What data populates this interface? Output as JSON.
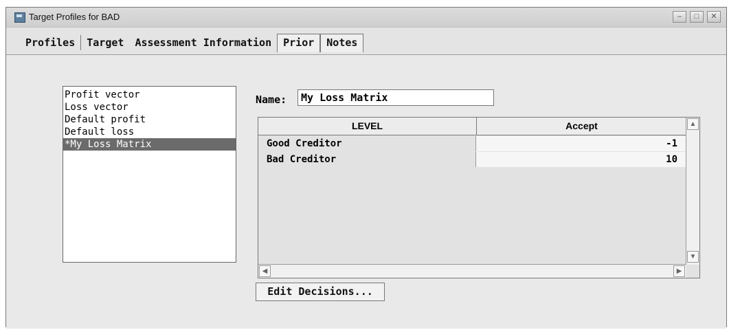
{
  "window": {
    "title": "Target Profiles for BAD",
    "controls": {
      "minimize": "–",
      "maximize": "□",
      "close": "✕"
    }
  },
  "tabs": [
    {
      "label": "Profiles"
    },
    {
      "label": "Target"
    },
    {
      "label": "Assessment Information"
    },
    {
      "label": "Prior"
    },
    {
      "label": "Notes"
    }
  ],
  "profiles_list": [
    {
      "label": "Profit vector"
    },
    {
      "label": "Loss vector"
    },
    {
      "label": "Default profit"
    },
    {
      "label": "Default loss"
    },
    {
      "label": "*My Loss Matrix"
    }
  ],
  "name_field": {
    "label": "Name:",
    "value": "My Loss Matrix"
  },
  "matrix": {
    "columns": [
      "LEVEL",
      "Accept"
    ],
    "rows": [
      {
        "level": "Good Creditor",
        "accept": "-1"
      },
      {
        "level": "Bad Creditor",
        "accept": "10"
      }
    ]
  },
  "edit_decisions_label": "Edit Decisions...",
  "icons": {
    "app": "target-profiles-icon",
    "up": "▲",
    "down": "▼",
    "left": "◀",
    "right": "▶"
  }
}
